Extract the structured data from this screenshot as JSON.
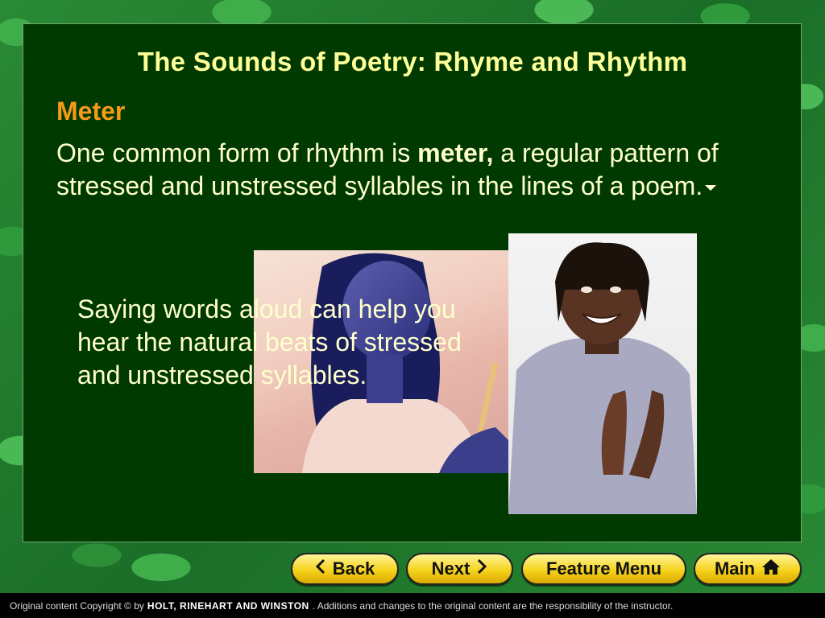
{
  "slide": {
    "title": "The Sounds of Poetry: Rhyme and Rhythm",
    "subheading": "Meter",
    "body_before": "One common form of rhythm is ",
    "body_bold": "meter,",
    "body_after": " a regular pattern of stressed and unstressed syllables in the lines of a poem.",
    "caption": "Saying words aloud can help you hear the natural beats of stressed and unstressed syllables."
  },
  "nav": {
    "back_label": "Back",
    "next_label": "Next",
    "feature_menu_label": "Feature Menu",
    "main_label": "Main"
  },
  "footer": {
    "prefix": "Original content Copyright © by",
    "publisher": "HOLT, RINEHART AND WINSTON",
    "suffix": ". Additions and changes to the original content are the responsibility of the instructor."
  },
  "images": {
    "photo1": "girl-playing-drums-photo",
    "photo2": "man-clapping-photo"
  },
  "colors": {
    "panel": "#003a00",
    "title": "#ffff99",
    "subheading": "#f59a1a",
    "text": "#ffffcc",
    "button": "#f5d31c"
  }
}
